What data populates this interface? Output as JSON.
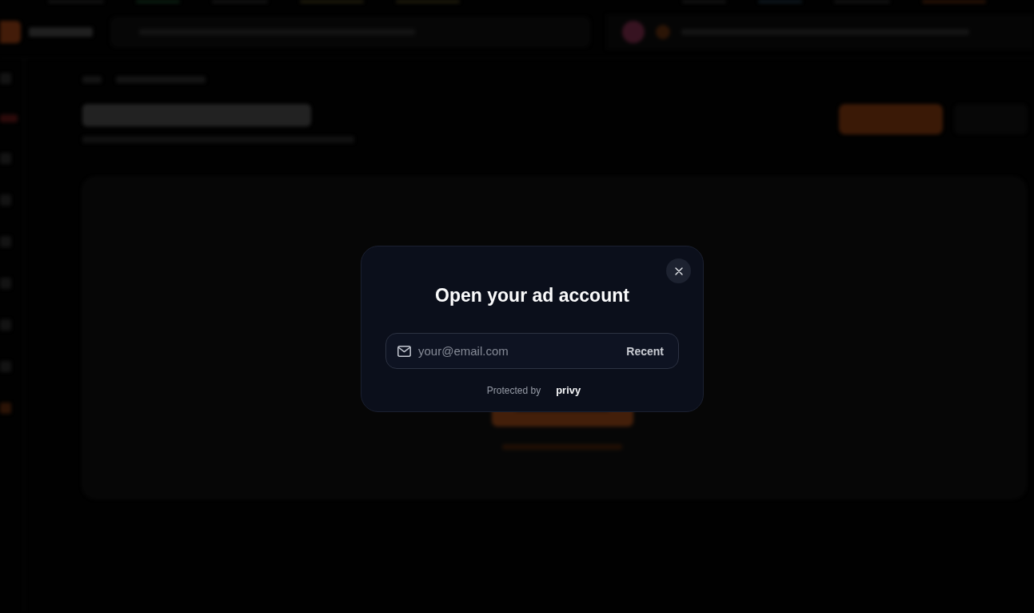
{
  "dialog": {
    "title": "Open your ad account",
    "email_field": {
      "placeholder": "your@email.com"
    },
    "recent_button": "Recent",
    "footer": {
      "protected_by": "Protected by",
      "brand": "privy"
    }
  }
}
